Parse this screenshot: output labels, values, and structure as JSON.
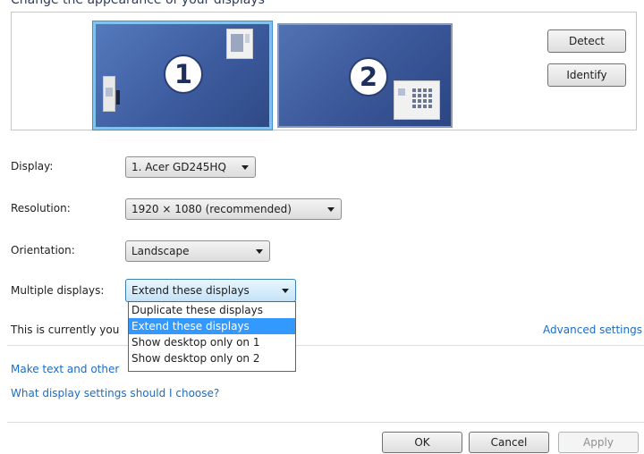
{
  "header": {
    "title": "Change the appearance of your displays"
  },
  "preview": {
    "monitors": [
      {
        "number": "1",
        "selected": true
      },
      {
        "number": "2",
        "selected": false
      }
    ],
    "detect_label": "Detect",
    "identify_label": "Identify"
  },
  "fields": {
    "display": {
      "label": "Display:",
      "value": "1. Acer GD245HQ"
    },
    "resolution": {
      "label": "Resolution:",
      "value": "1920 × 1080 (recommended)"
    },
    "orientation": {
      "label": "Orientation:",
      "value": "Landscape"
    },
    "multiple_displays": {
      "label": "Multiple displays:",
      "value": "Extend these displays",
      "options": [
        "Duplicate these displays",
        "Extend these displays",
        "Show desktop only on 1",
        "Show desktop only on 2"
      ],
      "selected_index": 1
    }
  },
  "status_text": "This is currently you",
  "links": {
    "advanced_settings": "Advanced settings",
    "make_text": "Make text and other",
    "what_settings": "What display settings should I choose?"
  },
  "footer": {
    "ok_label": "OK",
    "cancel_label": "Cancel",
    "apply_label": "Apply"
  },
  "colors": {
    "accent": "#3399ff",
    "link": "#1a6cc7",
    "monitor_selected_border": "#7fc4ef"
  }
}
